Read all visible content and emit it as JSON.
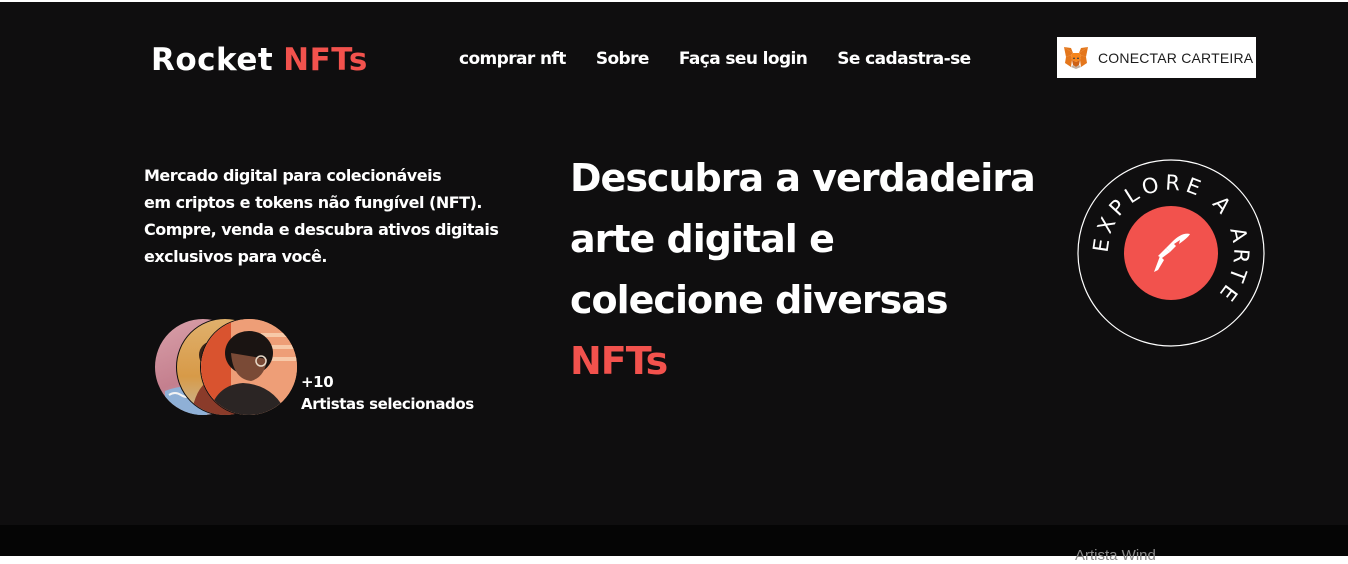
{
  "header": {
    "logo": {
      "part1": "Rocket",
      "part2": "NFTs"
    },
    "nav": [
      {
        "label": "comprar nft"
      },
      {
        "label": "Sobre"
      },
      {
        "label": "Faça seu login"
      },
      {
        "label": "Se cadastra-se"
      }
    ],
    "wallet_button": {
      "label": "CONECTAR CARTEIRA",
      "icon": "metamask-fox-icon"
    }
  },
  "hero": {
    "description_lines": [
      "Mercado digital para colecionáveis",
      "em criptos e tokens não fungível (NFT).",
      "Compre, venda e descubra ativos digitais",
      "exclusivos para você."
    ],
    "artists": {
      "count": "+10",
      "label": "Artistas selecionados"
    },
    "headline_lines": [
      "Descubra a verdadeira",
      "arte digital e",
      "colecione diversas"
    ],
    "headline_accent": "NFTs",
    "badge": {
      "ring_text": "EXPLORE A ARTE",
      "icon": "rocket-icon"
    }
  },
  "footer": {
    "partial_text": "Artista Wind"
  },
  "colors": {
    "background": "#0f0e0f",
    "accent": "#f2524d",
    "text": "#ffffff"
  }
}
